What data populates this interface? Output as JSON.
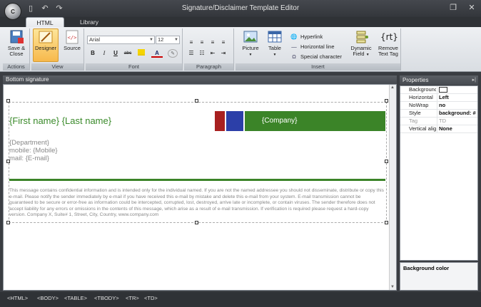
{
  "window": {
    "title": "Signature/Disclaimer Template Editor",
    "app_badge": "C"
  },
  "tabs": [
    {
      "label": "HTML"
    },
    {
      "label": "Library"
    }
  ],
  "ribbon": {
    "actions": {
      "label": "Actions",
      "save_close": "Save & Close"
    },
    "view": {
      "label": "View",
      "designer": "Designer",
      "source": "Source"
    },
    "font": {
      "label": "Font",
      "family": "Arial",
      "size": "12",
      "bold": "B",
      "italic": "I",
      "underline": "U",
      "strike": "abc",
      "color_letter": "A"
    },
    "paragraph": {
      "label": "Paragraph"
    },
    "insert": {
      "label": "Insert",
      "picture": "Picture",
      "table": "Table",
      "hyperlink": "Hyperlink",
      "horizontal_line": "Horizontal line",
      "special_character": "Special character",
      "dynamic_field": "Dynamic Field",
      "remove_text_tag": "Remove Text Tag",
      "rt_glyph": "{rt}"
    }
  },
  "editor": {
    "header": "Bottom signature",
    "name_line": "{First name} {Last name}",
    "company": "{Company}",
    "department": "{Department}",
    "mobile": "mobile: {Mobile}",
    "email": "mail: {E-mail}",
    "disclaimer": "This message contains confidential information and is intended only for the individual named. If you are not the named addressee you should not disseminate, distribute or copy this e-mail. Please notify the sender immediately by e-mail if you have received this e-mail by mistake and delete this e-mail from your system. E-mail transmission cannot be guaranteed to be secure or error-free as information could be intercepted, corrupted, lost, destroyed, arrive late or incomplete, or contain viruses. The sender therefore does not accept liability for any errors or omissions in the contents of this message, which arise as a result of e-mail transmission. If verification is required please request a hard-copy version. Company X, Suite# 1, Street, City, Country, www.company.com",
    "colors": {
      "name": "#3a8a2a",
      "red": "#a82020",
      "blue": "#2c3fa8",
      "green": "#3b8428"
    }
  },
  "properties": {
    "title": "Properties",
    "rows": [
      {
        "key": "Background",
        "value": ""
      },
      {
        "key": "Horizontal",
        "value": "Left"
      },
      {
        "key": "NoWrap",
        "value": "no"
      },
      {
        "key": "Style",
        "value": "background: #"
      },
      {
        "key": "Tag",
        "value": "TD"
      },
      {
        "key": "Vertical alig",
        "value": "None"
      }
    ],
    "description_title": "Background color"
  },
  "statusbar": {
    "crumbs": [
      "<HTML>",
      "<BODY>",
      "<TABLE>",
      "<TBODY>",
      "<TR>",
      "<TD>"
    ]
  }
}
